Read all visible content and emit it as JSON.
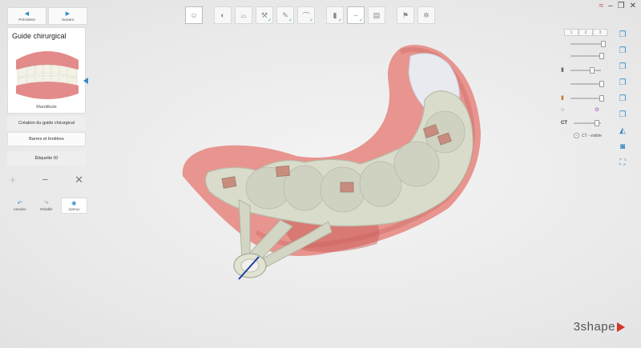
{
  "nav": {
    "prev_label": "Précédent",
    "next_label": "Suivant"
  },
  "panel": {
    "title": "Guide chirurgical",
    "preview_label": "Mandibule"
  },
  "steps": [
    {
      "label": "Création du guide chirurgical"
    },
    {
      "label": "Barres et fenêtres"
    },
    {
      "label": "Étiquette ID"
    }
  ],
  "tools": {
    "add": "+",
    "remove": "−",
    "delete": "✕"
  },
  "actions": [
    {
      "label": "Annuler",
      "icon": "undo-icon"
    },
    {
      "label": "Rétablir",
      "icon": "redo-icon"
    },
    {
      "label": "Aperçu",
      "icon": "eye-icon"
    }
  ],
  "layers": {
    "tabs": [
      "1",
      "2",
      "3"
    ],
    "ct_label": "CT",
    "ct_visible": "CT - visible"
  },
  "logo": {
    "text": "3shape"
  },
  "colors": {
    "accent": "#2a8cc8",
    "check": "#3bb04a",
    "logo_red": "#d6332b",
    "guide": "#d9dccb",
    "gum": "#e8948f"
  }
}
